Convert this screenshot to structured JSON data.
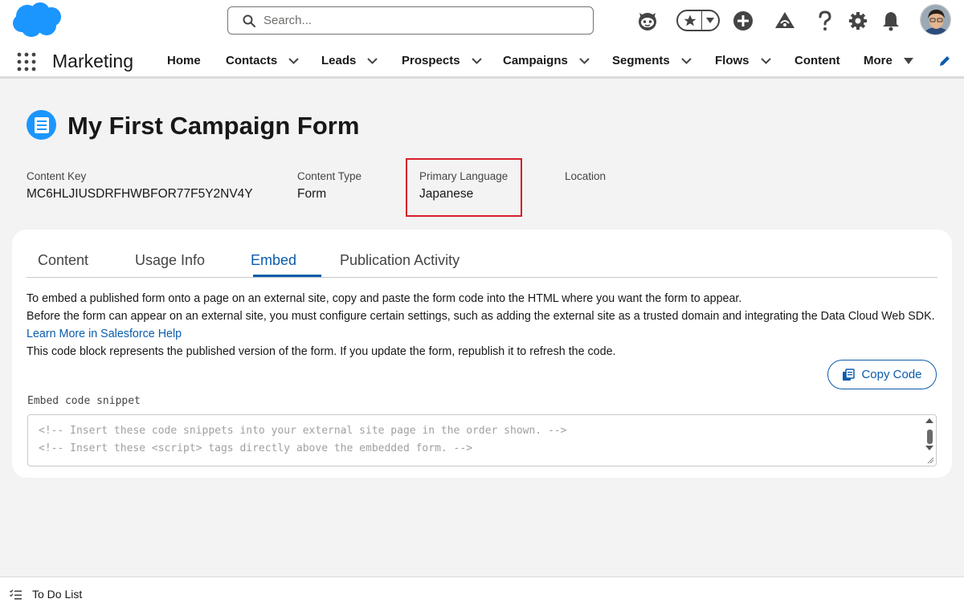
{
  "header": {
    "search_placeholder": "Search...",
    "brand_color": "#1b96ff"
  },
  "app_nav": {
    "app_name": "Marketing",
    "items": [
      {
        "label": "Home",
        "has_menu": false
      },
      {
        "label": "Contacts",
        "has_menu": true
      },
      {
        "label": "Leads",
        "has_menu": true
      },
      {
        "label": "Prospects",
        "has_menu": true
      },
      {
        "label": "Campaigns",
        "has_menu": true
      },
      {
        "label": "Segments",
        "has_menu": true
      },
      {
        "label": "Flows",
        "has_menu": true
      },
      {
        "label": "Content",
        "has_menu": false
      },
      {
        "label": "More",
        "has_menu": true
      }
    ]
  },
  "record": {
    "title": "My First Campaign Form",
    "fields": [
      {
        "label": "Content Key",
        "value": "MC6HLJIUSDRFHWBFOR77F5Y2NV4Y"
      },
      {
        "label": "Content Type",
        "value": "Form"
      },
      {
        "label": "Primary Language",
        "value": "Japanese"
      },
      {
        "label": "Location",
        "value": ""
      }
    ],
    "highlight_color": "#d71f28"
  },
  "tabs": [
    {
      "label": "Content",
      "active": false
    },
    {
      "label": "Usage Info",
      "active": false
    },
    {
      "label": "Embed",
      "active": true
    },
    {
      "label": "Publication Activity",
      "active": false
    }
  ],
  "embed": {
    "line1": "To embed a published form onto a page on an external site, copy and paste the form code into the HTML where you want the form to appear.",
    "line2": "Before the form can appear on an external site, you must configure certain settings, such as adding the external site as a trusted domain and integrating the Data Cloud Web SDK.",
    "link": "Learn More in Salesforce Help",
    "line3": "This code block represents the published version of the form. If you update the form, republish it to refresh the code.",
    "copy_button": "Copy Code",
    "snippet_label": "Embed code snippet",
    "code_lines": [
      "<!-- Insert these code snippets into your external site page in the order shown. -->",
      "<!-- Insert these <script> tags directly above the embedded form. -->"
    ]
  },
  "utility_bar": {
    "todo_label": "To Do List"
  }
}
